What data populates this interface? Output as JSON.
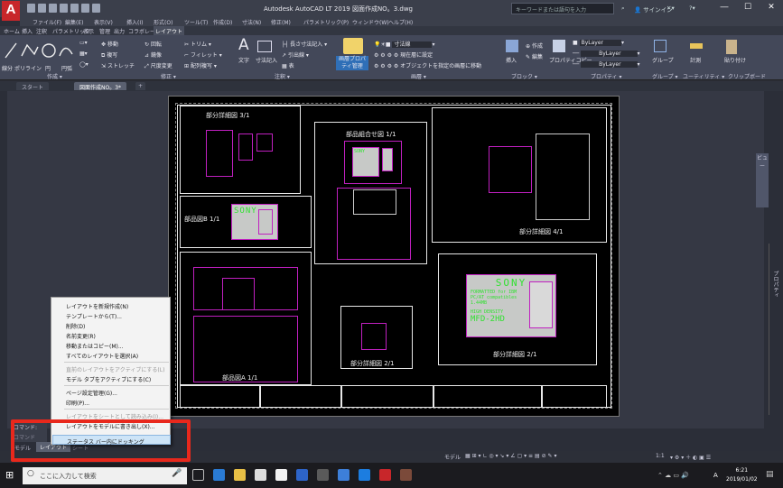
{
  "window": {
    "title": "Autodesk AutoCAD LT 2019   図面作成NO。3.dwg",
    "search_placeholder": "キーワードまたは語句を入力",
    "signin": "サインイン",
    "min": "―",
    "max": "☐",
    "close": "✕",
    "logo": "A",
    "logo_sub": "LT"
  },
  "menus": [
    "ファイル(F)",
    "編集(E)",
    "表示(V)",
    "挿入(I)",
    "形式(O)",
    "ツール(T)",
    "作成(D)",
    "寸法(N)",
    "修正(M)",
    "パラメトリック(P)",
    "ウィンドウ(W)",
    "ヘルプ(H)"
  ],
  "ribbon_tabs": [
    "ホーム",
    "挿入",
    "注釈",
    "パラメトリック",
    "表示",
    "管理",
    "出力",
    "コラボレート",
    "レイアウト"
  ],
  "ribbon_active": "レイアウト",
  "ribbon": {
    "draw": [
      "線分",
      "ポリライン",
      "円",
      "円弧"
    ],
    "draw_title": "作成 ▾",
    "modify": [
      "移動",
      "回転",
      "トリム",
      "複写",
      "鏡像",
      "フィレット",
      "ストレッチ",
      "尺度変更",
      "配列複写"
    ],
    "modify_title": "修正 ▾",
    "text": "文字",
    "dim": "寸法記入",
    "dim_items": [
      "長さ寸法記入",
      "引出線",
      "表"
    ],
    "annot_title": "注釈 ▾",
    "layer_prop": "画層プロパティ管理",
    "layer_items": [
      "寸法線",
      "現在層に設定",
      "オブジェクトを指定の画層に移動"
    ],
    "layer_title": "画層 ▾",
    "insert": "挿入",
    "block_items": [
      "作成",
      "編集"
    ],
    "block_title": "ブロック ▾",
    "prop": "プロパティコピー",
    "bylayer": "ByLayer",
    "prop_title": "プロパティ ▾",
    "group": "グループ",
    "group_title": "グループ ▾",
    "util": "計測",
    "util_title": "ユーティリティ ▾",
    "paste": "貼り付け",
    "clip_title": "クリップボード"
  },
  "file_tabs": [
    "スタート",
    "図面作成NO。3*",
    "+"
  ],
  "drawing": {
    "detail3": "部分詳細図 3/1",
    "assembly": "部品組合せ図 1/1",
    "detail4": "部分詳細図 4/1",
    "partB": "部品図B 1/1",
    "partA": "部品図A 1/1",
    "detail2a": "部分詳細図 2/1",
    "detail2b": "部分詳細図 2/1",
    "sony": "SONY",
    "formatted": "FORMATTED for IBM",
    "compat": "PC/AT compatibles",
    "size": "1.44MB",
    "density": "HIGH DENSITY",
    "model": "MFD-2HD"
  },
  "context_menu": [
    "レイアウトを新規作成(N)",
    "テンプレートから(T)...",
    "削除(D)",
    "名前変更(R)",
    "移動またはコピー(M)...",
    "すべてのレイアウトを選択(A)",
    "直前のレイアウトをアクティブにする(L)",
    "モデル タブをアクティブにする(C)",
    "ページ設定管理(G)...",
    "印刷(P)...",
    "レイアウトをシートとして読み込み(I)...",
    "レイアウトをモデルに書き出し(X)...",
    "ステータス バー内にドッキング"
  ],
  "command": {
    "label": "コマンド:",
    "placeholder": "コマンド"
  },
  "layout_tabs": [
    "モデル",
    "レイアウト",
    "シート"
  ],
  "status": {
    "mode": "モデル",
    "scale": "1:1"
  },
  "panels": {
    "view": "ビュー",
    "props": "プロパティ"
  },
  "taskbar": {
    "search": "ここに入力して検索",
    "time": "6:21",
    "date": "2019/01/02",
    "ime": "A"
  },
  "colors": {
    "accent": "#c8262a",
    "highlight": "#e8281c",
    "magenta": "#c020c0",
    "green": "#33e033"
  }
}
